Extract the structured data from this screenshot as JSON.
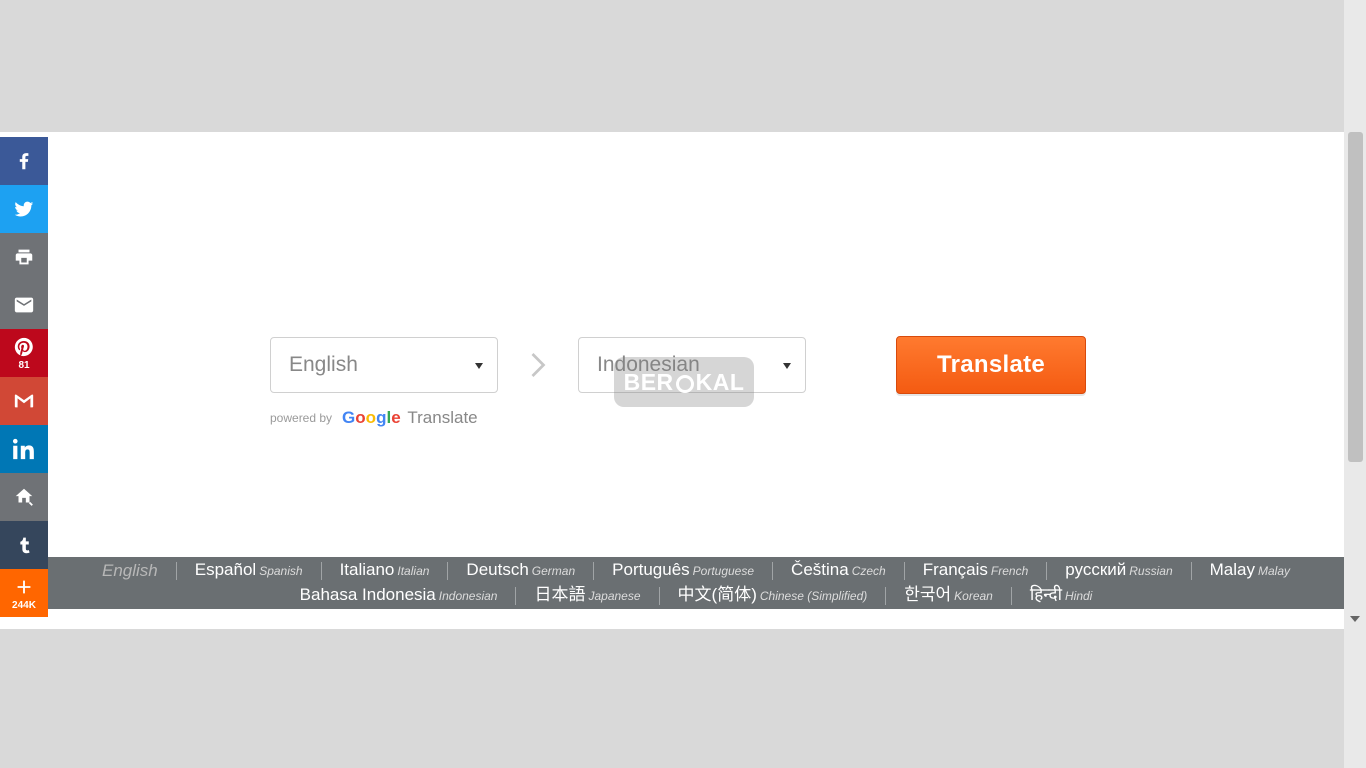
{
  "sidebar": {
    "pinterest_count": "81",
    "addthis_count": "244K"
  },
  "translator": {
    "source_lang": "English",
    "target_lang": "Indonesian",
    "translate_label": "Translate",
    "powered_by": "powered by",
    "google_translate_suffix": "Translate"
  },
  "watermark": {
    "left": "BER",
    "right": "KAL"
  },
  "languages": {
    "row1": [
      {
        "native": "English",
        "en": "",
        "active": true
      },
      {
        "native": "Español",
        "en": "Spanish"
      },
      {
        "native": "Italiano",
        "en": "Italian"
      },
      {
        "native": "Deutsch",
        "en": "German"
      },
      {
        "native": "Português",
        "en": "Portuguese"
      },
      {
        "native": "Čeština",
        "en": "Czech"
      },
      {
        "native": "Français",
        "en": "French"
      },
      {
        "native": "русский",
        "en": "Russian"
      },
      {
        "native": "Malay",
        "en": "Malay"
      }
    ],
    "row2": [
      {
        "native": "Bahasa Indonesia",
        "en": "Indonesian"
      },
      {
        "native": "日本語",
        "en": "Japanese"
      },
      {
        "native": "中文(简体)",
        "en": "Chinese (Simplified)"
      },
      {
        "native": "한국어",
        "en": "Korean"
      },
      {
        "native": "हिन्दी",
        "en": "Hindi"
      }
    ]
  }
}
